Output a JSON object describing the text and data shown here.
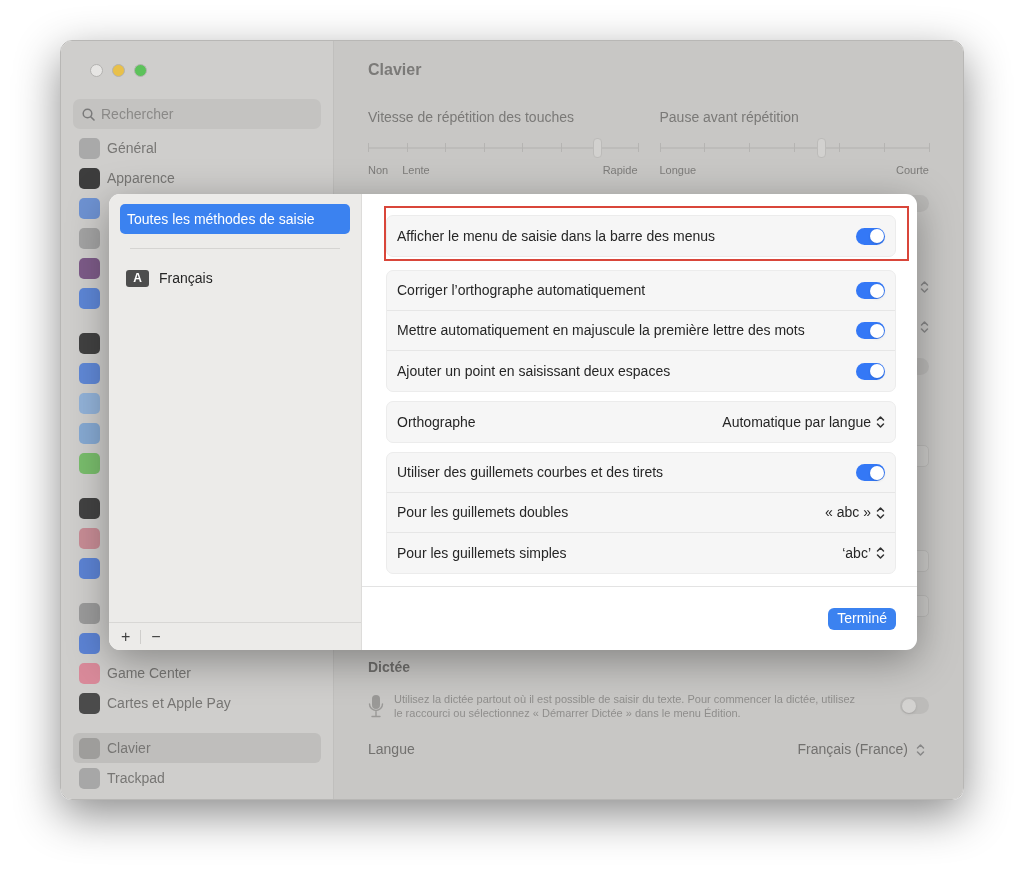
{
  "window": {
    "traffic_lights": [
      {
        "color": "#e6e5e3"
      },
      {
        "color": "#e8c04a"
      },
      {
        "color": "#5cc25a"
      }
    ]
  },
  "sidebar": {
    "search": {
      "placeholder": "Rechercher"
    },
    "sections": [
      [
        {
          "label": "Général",
          "color": "#a9a9a9",
          "selected": false
        },
        {
          "label": "Apparence",
          "color": "#3d3d3d",
          "selected": false
        },
        {
          "color": "#6e92d2",
          "selected": false
        },
        {
          "color": "#a3a3a3",
          "selected": false
        },
        {
          "color": "#7d5b88",
          "selected": false
        },
        {
          "color": "#5d86d6",
          "selected": false
        }
      ],
      [
        {
          "color": "#414141",
          "selected": false
        },
        {
          "color": "#6088d6",
          "selected": false
        },
        {
          "color": "#92b2d8",
          "selected": false
        },
        {
          "color": "#86a9d2",
          "selected": false
        },
        {
          "color": "#79bd6c",
          "selected": false
        }
      ],
      [
        {
          "color": "#424242",
          "selected": false
        },
        {
          "color": "#c78c95",
          "selected": false
        },
        {
          "color": "#5c83d4",
          "selected": false
        }
      ],
      [
        {
          "color": "#9b9b9b",
          "selected": false
        },
        {
          "color": "#5c83d4",
          "selected": false
        },
        {
          "label": "Game Center",
          "color": "#d98a9a",
          "selected": false
        },
        {
          "label": "Cartes et Apple Pay",
          "color": "#4b4b4b",
          "selected": false
        }
      ],
      [
        {
          "label": "Clavier",
          "color": "#9e9d9b",
          "selected": true
        },
        {
          "label": "Trackpad",
          "color": "#a7a7a7",
          "selected": false
        }
      ]
    ]
  },
  "main": {
    "title": "Clavier",
    "sliders": [
      {
        "label": "Vitesse de répétition des touches",
        "level": 0.85,
        "min_labels": [
          "Non",
          "Lente"
        ],
        "max_label": "Rapide"
      },
      {
        "label": "Pause avant répétition",
        "level": 0.6,
        "min_labels": [
          "Longue"
        ],
        "max_label": "Courte"
      }
    ],
    "control_groups": [
      [
        {
          "kind": "toggle",
          "on": false
        }
      ],
      [
        {
          "kind": "stepper"
        },
        {
          "kind": "stepper"
        },
        {
          "kind": "toggle",
          "on": false
        }
      ],
      [
        {
          "kind": "button"
        }
      ],
      [
        {
          "kind": "button"
        },
        {
          "kind": "button"
        }
      ]
    ],
    "dictation": {
      "heading": "Dictée",
      "description": "Utilisez la dictée partout où il est possible de saisir du texte. Pour commencer la dictée, utilisez le raccourci ou sélectionnez « Démarrer Dictée » dans le menu Édition.",
      "on": false,
      "language_label": "Langue",
      "language_value": "Français (France)"
    }
  },
  "sheet": {
    "input_sources": [
      {
        "kind": "all",
        "label": "Toutes les méthodes de saisie",
        "selected": true
      },
      {
        "kind": "language",
        "badge": "A",
        "label": "Français",
        "selected": false
      }
    ],
    "footer": {
      "add": "+",
      "remove": "−"
    },
    "groups": [
      {
        "highlighted": true,
        "rows": [
          {
            "kind": "toggle",
            "label": "Afficher le menu de saisie dans la barre des menus",
            "on": true
          }
        ]
      },
      {
        "highlighted": false,
        "rows": [
          {
            "kind": "toggle",
            "label": "Corriger l’orthographe automatiquement",
            "on": true
          },
          {
            "kind": "toggle",
            "label": "Mettre automatiquement en majuscule la première lettre des mots",
            "on": true
          },
          {
            "kind": "toggle",
            "label": "Ajouter un point en saisissant deux espaces",
            "on": true
          }
        ]
      },
      {
        "highlighted": false,
        "rows": [
          {
            "kind": "popup",
            "label": "Orthographe",
            "value": "Automatique par langue"
          }
        ]
      },
      {
        "highlighted": false,
        "rows": [
          {
            "kind": "toggle",
            "label": "Utiliser des guillemets courbes et des tirets",
            "on": true
          },
          {
            "kind": "popup",
            "label": "Pour les guillemets doubles",
            "value": "« abc »"
          },
          {
            "kind": "popup",
            "label": "Pour les guillemets simples",
            "value": "‘abc’"
          }
        ]
      }
    ],
    "done_button": "Terminé"
  }
}
